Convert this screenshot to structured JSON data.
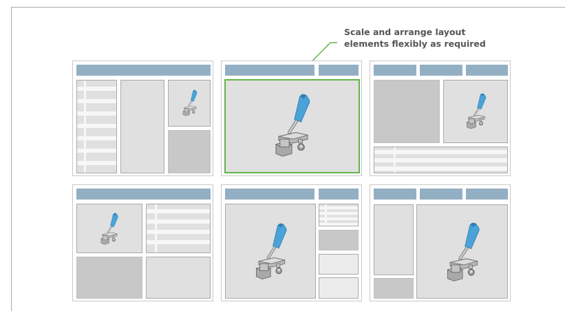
{
  "annotation": {
    "line1": "Scale and arrange layout",
    "line2": "elements flexibly as required"
  },
  "colors": {
    "header": "#93afc3",
    "highlight": "#62b34a",
    "block_light": "#e0e0e0",
    "block_dark": "#c8c8c8",
    "lever": "#4aa3d8"
  },
  "icons": {
    "figure": "clamp-product-icon"
  }
}
